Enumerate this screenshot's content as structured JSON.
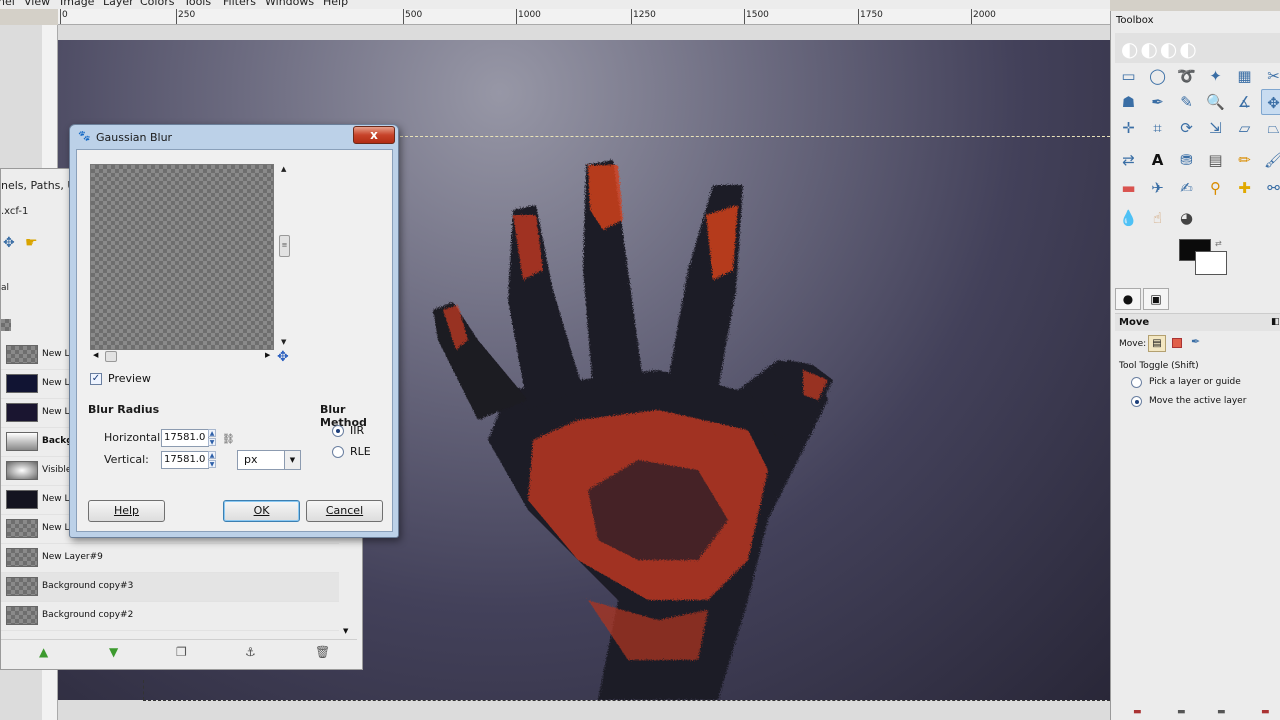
{
  "menubar": {
    "items": [
      "nel",
      "View",
      "Image",
      "Layer",
      "Colors",
      "Tools",
      "Filters",
      "Windows",
      "Help"
    ]
  },
  "ruler": {
    "labels": [
      "0",
      "250",
      "500",
      "1000",
      "1250",
      "1500",
      "1750",
      "2000"
    ]
  },
  "layers_panel": {
    "tabs_text": "nels, Paths, Ur",
    "file_text": ".xcf-1",
    "mode_text": "al",
    "layers": [
      {
        "name": "New La",
        "thumb": "checker"
      },
      {
        "name": "New La",
        "thumb": "#111433"
      },
      {
        "name": "New La",
        "thumb": "#1a1530"
      },
      {
        "name": "Backgr",
        "thumb": "gradient",
        "bold": true
      },
      {
        "name": "Visible",
        "thumb": "glow"
      },
      {
        "name": "New La",
        "thumb": "#141420"
      },
      {
        "name": "New La",
        "thumb": "checker"
      },
      {
        "name": "New Layer#9",
        "thumb": "checker"
      },
      {
        "name": "Background copy#3",
        "thumb": "checker"
      },
      {
        "name": "Background copy#2",
        "thumb": "checker"
      }
    ]
  },
  "dialog": {
    "title": "Gaussian Blur",
    "close_label": "x",
    "preview_label": "Preview",
    "preview_checked": true,
    "blur_radius_label": "Blur Radius",
    "horizontal_label": "Horizontal:",
    "horizontal_value": "17581.0",
    "vertical_label": "Vertical:",
    "vertical_value": "17581.0",
    "unit": "px",
    "blur_method_label": "Blur Method",
    "methods": [
      {
        "label": "IIR",
        "selected": true
      },
      {
        "label": "RLE",
        "selected": false
      }
    ],
    "help_label": "Help",
    "ok_label": "OK",
    "cancel_label": "Cancel"
  },
  "toolbox": {
    "title": "Toolbox",
    "tool_options_title": "Move",
    "move_label": "Move:",
    "tool_toggle_label": "Tool Toggle  (Shift)",
    "options": [
      {
        "label": "Pick a layer or guide",
        "selected": false
      },
      {
        "label": "Move the active layer",
        "selected": true
      }
    ],
    "foreground_color": "#0b0b0b",
    "background_color": "#ffffff"
  }
}
